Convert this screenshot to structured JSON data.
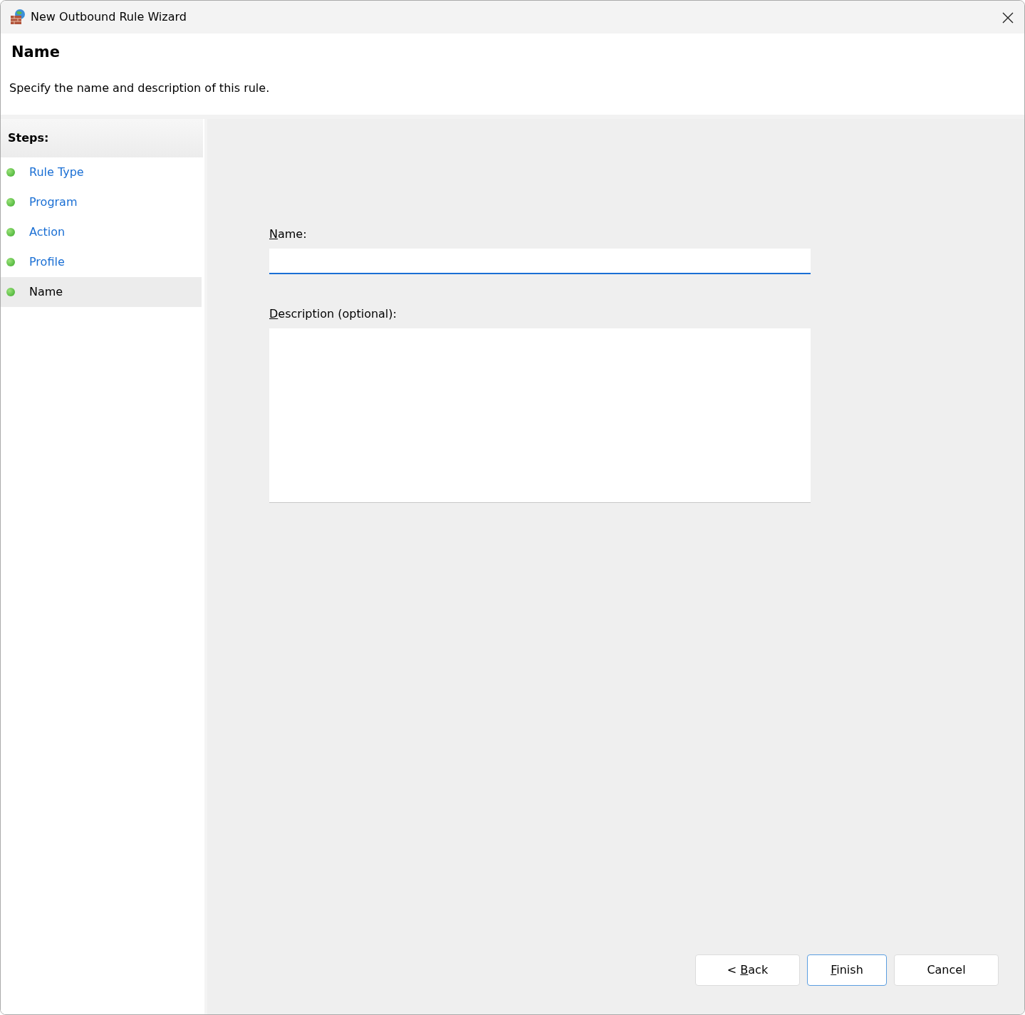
{
  "window": {
    "title": "New Outbound Rule Wizard"
  },
  "header": {
    "title": "Name",
    "subtitle": "Specify the name and description of this rule."
  },
  "steps": {
    "heading": "Steps:",
    "items": [
      {
        "label": "Rule Type",
        "selected": false
      },
      {
        "label": "Program",
        "selected": false
      },
      {
        "label": "Action",
        "selected": false
      },
      {
        "label": "Profile",
        "selected": false
      },
      {
        "label": "Name",
        "selected": true
      }
    ]
  },
  "form": {
    "fields": [
      {
        "kind": "line",
        "label": {
          "access_key": "N",
          "after": "ame:"
        }
      },
      {
        "kind": "multiline",
        "label": {
          "access_key": "D",
          "after": "escription (optional):"
        }
      }
    ]
  },
  "buttons": [
    {
      "label": {
        "before": "< ",
        "access_key": "B",
        "after": "ack"
      },
      "default": false
    },
    {
      "label": {
        "access_key": "F",
        "after": "inish"
      },
      "default": true
    },
    {
      "label": {
        "before": "Cancel"
      },
      "default": false
    }
  ]
}
